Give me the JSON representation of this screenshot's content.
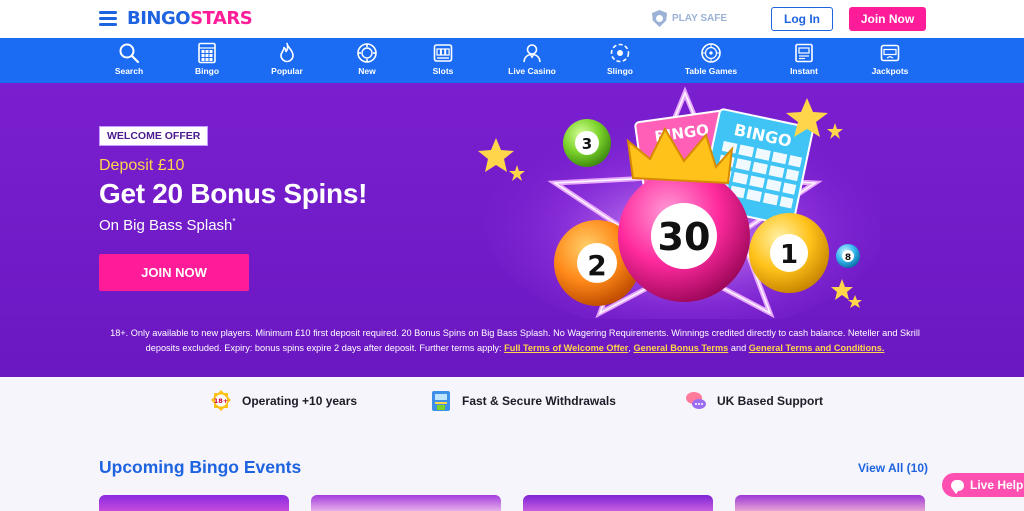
{
  "header": {
    "logo_part1": "BINGO",
    "logo_part2": "STARS",
    "play_safe": "PLAY SAFE",
    "login": "Log In",
    "join": "Join Now"
  },
  "nav": {
    "items": [
      {
        "label": "Search",
        "icon": "search-icon"
      },
      {
        "label": "Bingo",
        "icon": "bingo-card-icon"
      },
      {
        "label": "Popular",
        "icon": "flame-icon"
      },
      {
        "label": "New",
        "icon": "new-chip-icon"
      },
      {
        "label": "Slots",
        "icon": "slot-machine-icon"
      },
      {
        "label": "Live Casino",
        "icon": "dealer-icon"
      },
      {
        "label": "Slingo",
        "icon": "slingo-icon"
      },
      {
        "label": "Table Games",
        "icon": "roulette-icon"
      },
      {
        "label": "Instant",
        "icon": "instant-icon"
      },
      {
        "label": "Jackpots",
        "icon": "jackpot-icon"
      }
    ]
  },
  "hero": {
    "badge": "WELCOME OFFER",
    "deposit": "Deposit £10",
    "headline": "Get 20 Bonus Spins!",
    "subline": "On Big Bass Splash",
    "subline_mark": "*",
    "cta": "JOIN NOW",
    "art": {
      "ticket_text": "BINGO",
      "ball_main": "30",
      "ball_3": "3",
      "ball_2": "2",
      "ball_1": "1",
      "ball_8": "8"
    },
    "terms_text": "18+. Only available to new players. Minimum £10 first deposit required. 20 Bonus Spins on Big Bass Splash. No Wagering Requirements. Winnings credited directly to cash balance. Neteller and Skrill deposits excluded. Expiry: bonus spins expire 2 days after deposit. Further terms apply:",
    "terms_link1": "Full Terms of Welcome Offer",
    "terms_sep1": ",",
    "terms_link2": "General Bonus Terms",
    "terms_and": "and",
    "terms_link3": "General Terms and Conditions."
  },
  "features": [
    {
      "label": "Operating +10 years",
      "icon": "age-18-badge-icon"
    },
    {
      "label": "Fast & Secure Withdrawals",
      "icon": "atm-icon"
    },
    {
      "label": "UK Based Support",
      "icon": "chat-bubbles-icon"
    }
  ],
  "events": {
    "title": "Upcoming Bingo Events",
    "view_all": "View All (10)"
  },
  "live_help": "Live Help",
  "colors": {
    "brand_blue": "#1e63e0",
    "brand_pink": "#ff1c99",
    "nav_blue": "#1b6cf2",
    "hero_purple": "#7a1fcf",
    "gold": "#ffd54a"
  }
}
